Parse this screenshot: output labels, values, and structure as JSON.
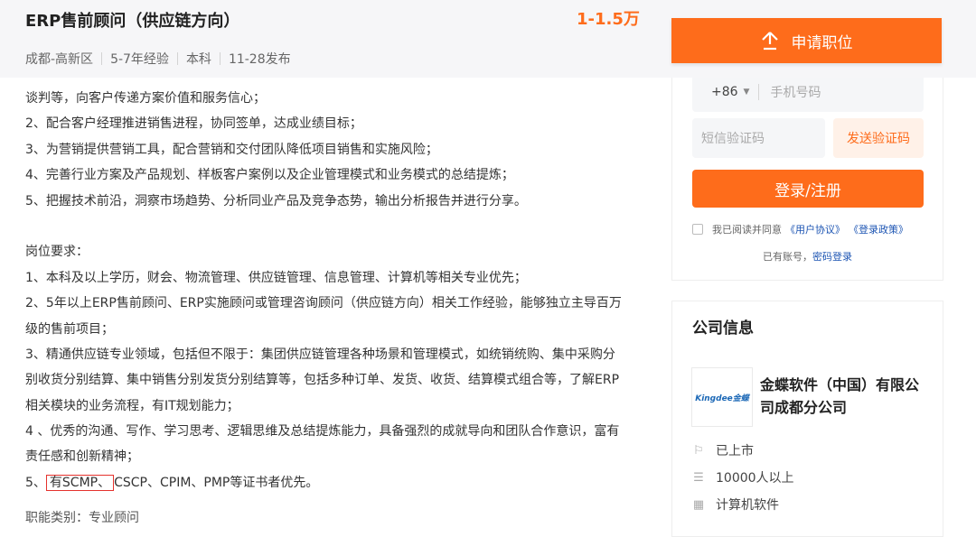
{
  "job": {
    "title": "ERP售前顾问（供应链方向）",
    "salary": "1-1.5万",
    "meta": [
      "成都-高新区",
      "5-7年经验",
      "本科",
      "11-28发布"
    ]
  },
  "apply": {
    "label": "申请职位"
  },
  "description": {
    "lines": [
      "谈判等，向客户传递方案价值和服务信心；",
      "2、配合客户经理推进销售进程，协同签单，达成业绩目标；",
      "3、为营销提供营销工具，配合营销和交付团队降低项目销售和实施风险；",
      "4、完善行业方案及产品规划、样板客户案例以及企业管理模式和业务模式的总结提炼；",
      "5、把握技术前沿，洞察市场趋势、分析同业产品及竞争态势，输出分析报告并进行分享。",
      "",
      "岗位要求：",
      "1、本科及以上学历，财会、物流管理、供应链管理、信息管理、计算机等相关专业优先；",
      "2、5年以上ERP售前顾问、ERP实施顾问或管理咨询顾问（供应链方向）相关工作经验，能够独立主导百万",
      "级的售前项目；",
      "3、精通供应链专业领域，包括但不限于：集团供应链管理各种场景和管理模式，如统销统购、集中采购分",
      "别收货分别结算、集中销售分别发货分别结算等，包括多种订单、发货、收货、结算模式组合等，了解ERP",
      "相关模块的业务流程，有IT规划能力；",
      "4 、优秀的沟通、写作、学习思考、逻辑思维及总结提炼能力，具备强烈的成就导向和团队合作意识，富有",
      "责任感和创新精神；"
    ],
    "last_line": {
      "prefix": "5、",
      "highlight": "有SCMP、",
      "rest": "CSCP、CPIM、PMP等证书者优先。"
    },
    "category": "职能类别：专业顾问"
  },
  "login": {
    "country_code": "+86",
    "phone_placeholder": "手机号码",
    "sms_placeholder": "短信验证码",
    "send_code": "发送验证码",
    "submit": "登录/注册",
    "agree_text": "我已阅读并同意",
    "agreement_link": "《用户协议》",
    "policy_link": "《登录政策》",
    "has_account": "已有账号，",
    "password_login": "密码登录"
  },
  "company": {
    "section_title": "公司信息",
    "logo_text": "Kingdee金蝶",
    "name": "金蝶软件（中国）有限公司成都分公司",
    "info": [
      {
        "icon": "flag-icon",
        "text": "已上市"
      },
      {
        "icon": "list-icon",
        "text": "10000人以上"
      },
      {
        "icon": "building-icon",
        "text": "计算机软件"
      }
    ]
  },
  "colors": {
    "accent": "#fe6c1b",
    "link": "#1d55b3",
    "highlight_border": "#e5322d"
  }
}
